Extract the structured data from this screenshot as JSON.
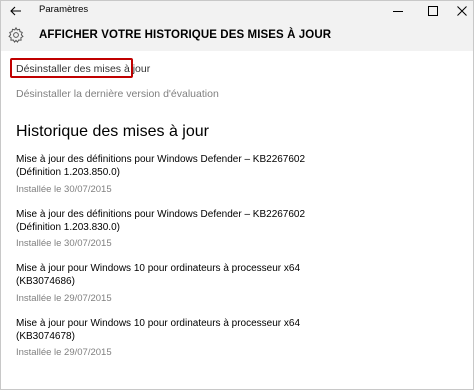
{
  "window": {
    "title": "Paramètres",
    "icons": {
      "back": "back-arrow-icon",
      "minimize": "minimize-icon",
      "maximize": "maximize-icon",
      "close": "close-icon"
    }
  },
  "header": {
    "title": "AFFICHER VOTRE HISTORIQUE DES MISES À JOUR",
    "icon": "gear-icon"
  },
  "links": {
    "uninstall_updates": "Désinstaller des mises à jour",
    "uninstall_preview": "Désinstaller la dernière version d'évaluation"
  },
  "colors": {
    "highlight_border": "#c00000",
    "secondary_text": "#808080",
    "chrome_background": "#f2f2f2"
  },
  "history": {
    "heading": "Historique des mises à jour",
    "updates": [
      {
        "line1": "Mise à jour des définitions pour Windows Defender – KB2267602",
        "line2": "(Définition 1.203.850.0)",
        "status": "Installée le 30/07/2015"
      },
      {
        "line1": "Mise à jour des définitions pour Windows Defender – KB2267602",
        "line2": "(Définition 1.203.830.0)",
        "status": "Installée le 30/07/2015"
      },
      {
        "line1": "Mise à jour pour Windows 10 pour ordinateurs à processeur x64",
        "line2": "(KB3074686)",
        "status": "Installée le 29/07/2015"
      },
      {
        "line1": "Mise à jour pour Windows 10 pour ordinateurs à processeur x64",
        "line2": "(KB3074678)",
        "status": "Installée le 29/07/2015"
      }
    ]
  }
}
